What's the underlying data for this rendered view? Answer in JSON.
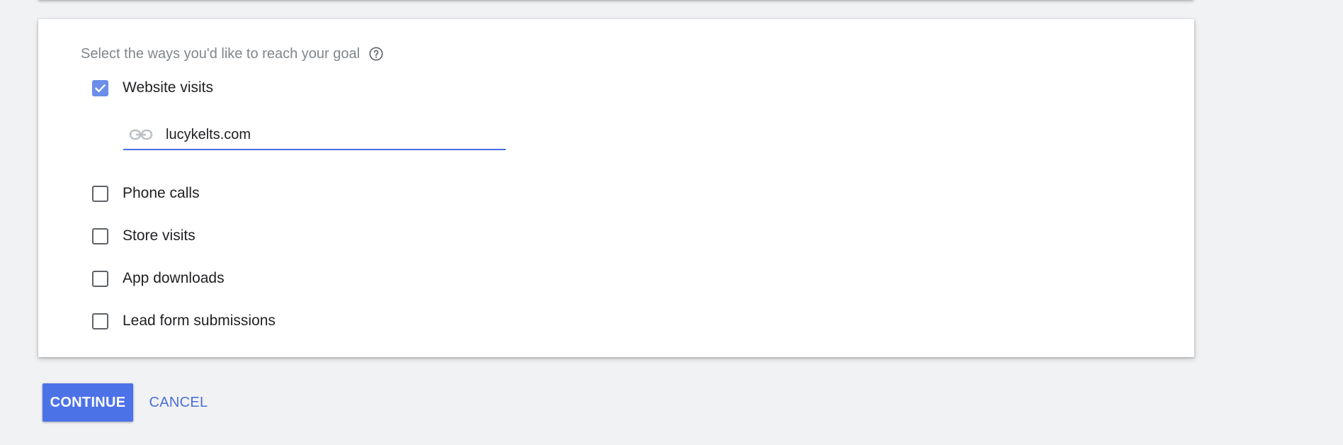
{
  "goal_section": {
    "heading": "Select the ways you'd like to reach your goal",
    "help_icon": "help-circle-icon",
    "options": [
      {
        "label": "Website visits",
        "checked": true
      },
      {
        "label": "Phone calls",
        "checked": false
      },
      {
        "label": "Store visits",
        "checked": false
      },
      {
        "label": "App downloads",
        "checked": false
      },
      {
        "label": "Lead form submissions",
        "checked": false
      }
    ],
    "website_field": {
      "icon": "link-icon",
      "value": "lucykelts.com"
    }
  },
  "actions": {
    "continue_label": "CONTINUE",
    "cancel_label": "CANCEL"
  },
  "colors": {
    "accent": "#4c72e8",
    "checkbox_checked": "#6b8ee8",
    "background": "#f1f2f4"
  }
}
